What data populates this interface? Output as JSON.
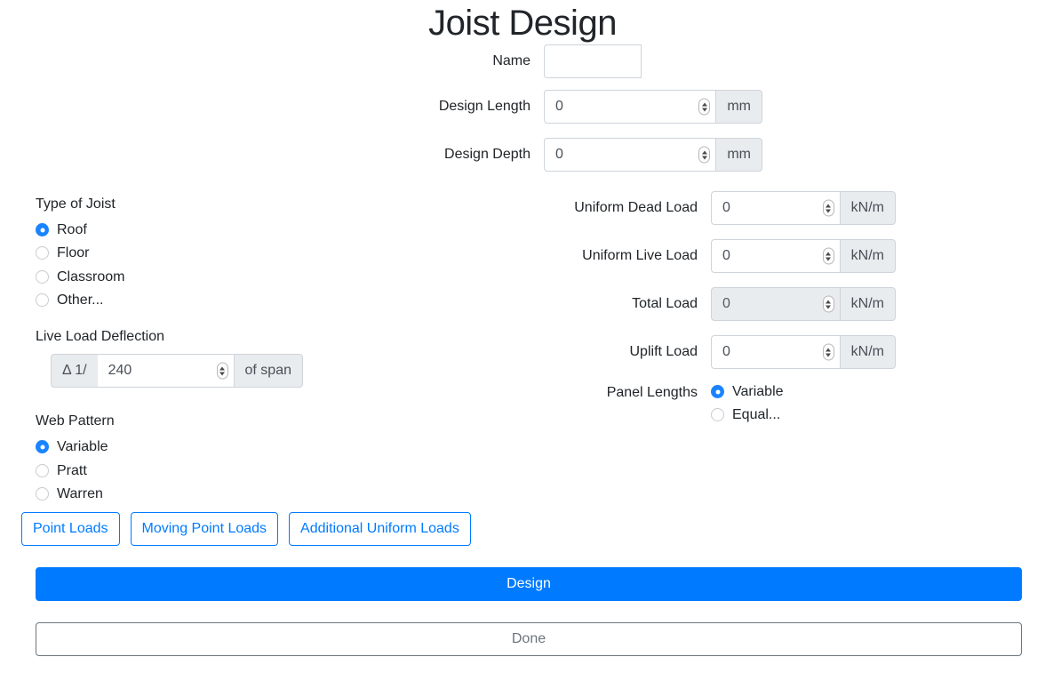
{
  "page": {
    "title": "Joist Design",
    "accent_color": "#007bff",
    "radio_selected_color": "#1a84ff",
    "disabled_bg": "#e9ecef"
  },
  "top_fields": [
    {
      "label": "Name",
      "value": "",
      "placeholder": "",
      "unit": null,
      "type": "text",
      "disabled": false
    },
    {
      "label": "Design Length",
      "value": "0",
      "placeholder": "",
      "unit": "mm",
      "type": "number",
      "disabled": false
    },
    {
      "label": "Design Depth",
      "value": "0",
      "placeholder": "",
      "unit": "mm",
      "type": "number",
      "disabled": false
    }
  ],
  "type_of_joist": {
    "heading": "Type of Joist",
    "options": [
      {
        "label": "Roof",
        "checked": true
      },
      {
        "label": "Floor",
        "checked": false
      },
      {
        "label": "Classroom",
        "checked": false
      },
      {
        "label": "Other...",
        "checked": false
      }
    ]
  },
  "live_load_deflection": {
    "heading": "Live Load Deflection",
    "prefix": "Δ 1/",
    "value": "240",
    "suffix": "of span"
  },
  "web_pattern": {
    "heading": "Web Pattern",
    "options": [
      {
        "label": "Variable",
        "checked": true
      },
      {
        "label": "Pratt",
        "checked": false
      },
      {
        "label": "Warren",
        "checked": false
      }
    ]
  },
  "load_fields": [
    {
      "label": "Uniform Dead Load",
      "value": "0",
      "unit": "kN/m",
      "disabled": false
    },
    {
      "label": "Uniform Live Load",
      "value": "0",
      "unit": "kN/m",
      "disabled": false
    },
    {
      "label": "Total Load",
      "value": "0",
      "unit": "kN/m",
      "disabled": true
    },
    {
      "label": "Uplift Load",
      "value": "0",
      "unit": "kN/m",
      "disabled": false
    }
  ],
  "panel_lengths": {
    "label": "Panel Lengths",
    "options": [
      {
        "label": "Variable",
        "checked": true
      },
      {
        "label": "Equal...",
        "checked": false
      }
    ]
  },
  "load_buttons": [
    {
      "label": "Point Loads"
    },
    {
      "label": "Moving Point Loads"
    },
    {
      "label": "Additional Uniform Loads"
    }
  ],
  "actions": {
    "design_label": "Design",
    "done_label": "Done"
  }
}
